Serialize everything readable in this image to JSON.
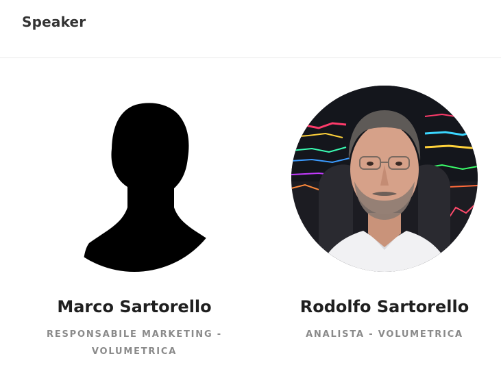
{
  "section": {
    "title": "Speaker"
  },
  "speakers": [
    {
      "name": "Marco Sartorello",
      "role": "RESPONSABILE MARKETING - VOLUMETRICA",
      "avatar_icon": "silhouette-placeholder-icon"
    },
    {
      "name": "Rodolfo Sartorello",
      "role": "ANALISTA - VOLUMETRICA",
      "avatar_icon": "person-photo"
    }
  ],
  "colors": {
    "title": "#333333",
    "name": "#1f1f1f",
    "role": "#8a8a8a",
    "divider": "#e8e8e8"
  }
}
